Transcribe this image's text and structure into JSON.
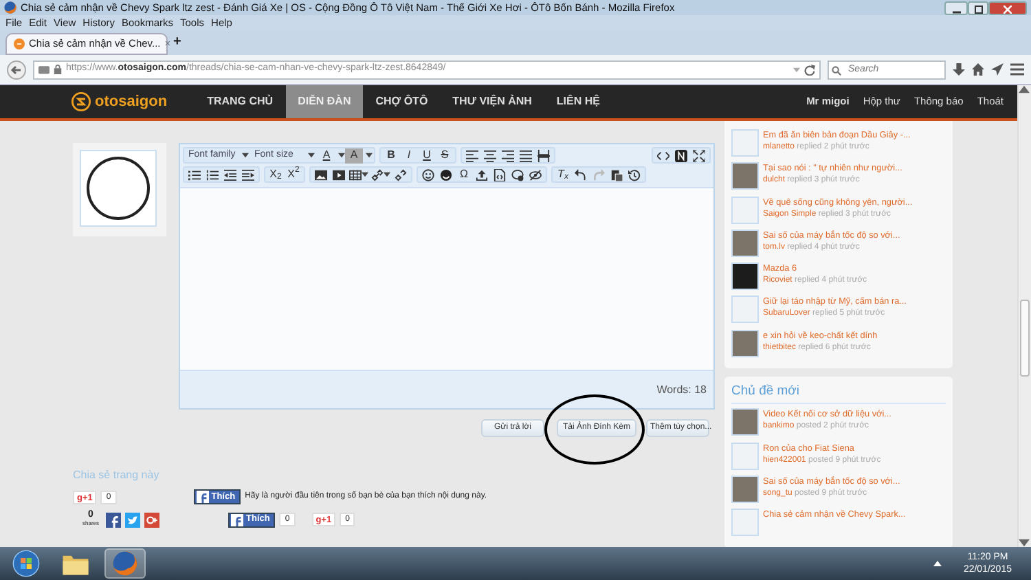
{
  "window": {
    "title": "Chia sẻ cảm nhận về Chevy Spark ltz zest - Đánh Giá Xe | OS - Cộng Đồng Ô Tô Việt Nam - Thế Giới Xe Hơi - ÔTô Bốn Bánh - Mozilla Firefox"
  },
  "menu": [
    "File",
    "Edit",
    "View",
    "History",
    "Bookmarks",
    "Tools",
    "Help"
  ],
  "browser_tabs": [
    {
      "label": "Chia sẻ cảm nhận về Chev...",
      "selected": true,
      "close": "×"
    }
  ],
  "new_tab": "+",
  "address": {
    "url": "https://www.**otosaigon.com**/threads/chia-se-cam-nhan-ve-chevy-spark-ltz-zest.8642849/"
  },
  "search": {
    "placeholder": "Search"
  },
  "site_nav": {
    "logo": "otosaigon",
    "items": [
      {
        "label": "TRANG CHỦ",
        "selected": false
      },
      {
        "label": "DIỄN ĐÀN",
        "selected": true
      },
      {
        "label": "CHỢ ÔTÔ",
        "selected": false
      },
      {
        "label": "THƯ VIỆN ẢNH",
        "selected": false
      },
      {
        "label": "LIÊN HỆ",
        "selected": false
      }
    ],
    "user_links": [
      "Mr migoi",
      "Hộp thư",
      "Thông báo",
      "Thoát"
    ]
  },
  "editor": {
    "font_family": "Font family",
    "font_size": "Font size",
    "glyphs": [
      "A",
      "A",
      "B",
      "I",
      "U",
      "S",
      "X$_{2}$",
      "X$^{2}$",
      "Ω",
      "T$_{x}$"
    ],
    "word_count": "Words: 18"
  },
  "actions": [
    "Gửi trả lời",
    "Tải Ảnh Đính Kèm",
    "Thêm tùy chọn..."
  ],
  "share": {
    "heading": "Chia sẻ trang này",
    "gplus_label": "g+1",
    "gplus_count": "0",
    "like_label": "Thích",
    "like_text": "Hãy là người đầu tiên trong số bạn bè của bạn thích nội dung này.",
    "shares_count": "0",
    "shares_label": "shares",
    "like_label_2": "Thích",
    "like_count": "0",
    "gplus_label_2": "g+1",
    "gplus_count_2": "0"
  },
  "recent_replies": [
    {
      "title": "Em đã ăn biên bản đoạn Dầu Giây -...",
      "user": "mlanetto",
      "meta": "replied 2 phút trước",
      "kind": "blank"
    },
    {
      "title": "Tại sao nói : \" tự nhiên như người...",
      "user": "dulcht",
      "meta": "replied 3 phút trước",
      "kind": "photo"
    },
    {
      "title": "Về quê sống cũng không yên, người...",
      "user": "Saigon Simple",
      "meta": "replied 3 phút trước",
      "kind": "blank"
    },
    {
      "title": "Sai số của máy bắn tốc độ so với...",
      "user": "tom.lv",
      "meta": "replied 4 phút trước",
      "kind": "photo"
    },
    {
      "title": "Mazda 6",
      "user": "Ricoviet",
      "meta": "replied 4 phút trước",
      "kind": "dark"
    },
    {
      "title": "Giữ lại táo nhập từ Mỹ, cấm bán ra...",
      "user": "SubaruLover",
      "meta": "replied 5 phút trước",
      "kind": "blank"
    },
    {
      "title": "e xin hỏi về keo-chất kết dính",
      "user": "thietbitec",
      "meta": "replied 6 phút trước",
      "kind": "photo"
    }
  ],
  "new_threads": {
    "heading": "Chủ đề mới",
    "items": [
      {
        "title": "Video Kết nối cơ sở dữ liệu với...",
        "user": "bankimo",
        "meta": "posted 2 phút trước",
        "kind": "photo"
      },
      {
        "title": "Ron của cho Fiat Siena",
        "user": "hien422001",
        "meta": "posted 9 phút trước",
        "kind": "blank"
      },
      {
        "title": "Sai số của máy bắn tốc độ so với...",
        "user": "song_tu",
        "meta": "posted 9 phút trước",
        "kind": "photo"
      },
      {
        "title": "Chia sẻ cảm nhận về Chevy Spark...",
        "kind": "blank"
      }
    ]
  },
  "taskbar": {
    "time": "11:20 PM",
    "date": "22/01/2015"
  }
}
